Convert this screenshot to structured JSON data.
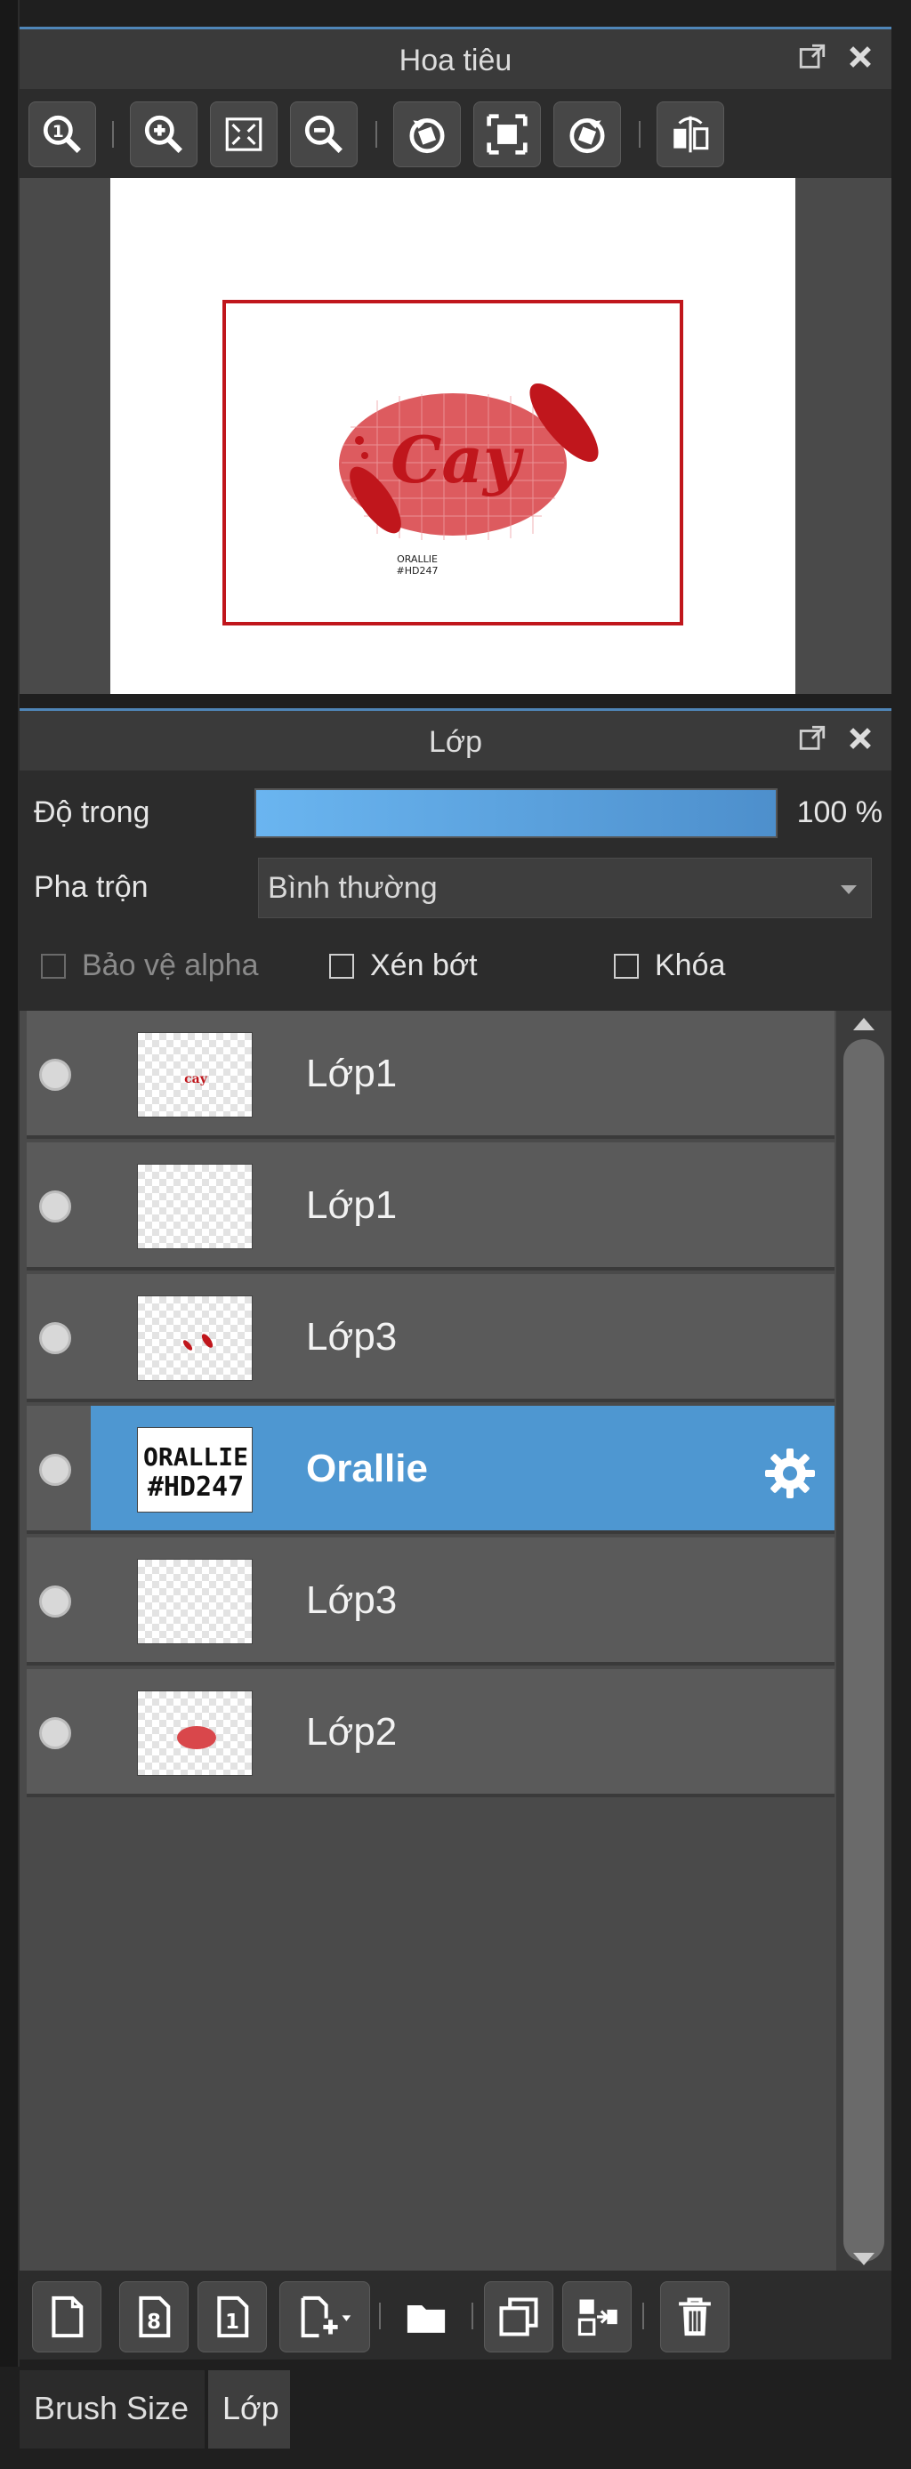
{
  "navigator": {
    "title": "Hoa tiêu",
    "preview": {
      "main_text": "Cay",
      "small_text_line1": "ORALLIE",
      "small_text_line2": "#HD247"
    },
    "tools": [
      "zoom-reset-icon",
      "zoom-in-icon",
      "fit-icon",
      "zoom-out-icon",
      "rotate-left-icon",
      "fit-window-icon",
      "rotate-right-icon",
      "flip-icon"
    ]
  },
  "layers_panel": {
    "title": "Lớp",
    "opacity_label": "Độ trong",
    "opacity_value": "100 %",
    "opacity_fraction": 1.0,
    "blend_label": "Pha trộn",
    "blend_value": "Bình thường",
    "protect_alpha": "Bảo vệ alpha",
    "clipping": "Xén bớt",
    "lock": "Khóa",
    "layers": [
      {
        "name": "Lớp1",
        "selected": false
      },
      {
        "name": "Lớp1",
        "selected": false
      },
      {
        "name": "Lớp3",
        "selected": false
      },
      {
        "name": "Orallie",
        "selected": true,
        "thumb_line1": "ORALLIE",
        "thumb_line2": "#HD247"
      },
      {
        "name": "Lớp3",
        "selected": false
      },
      {
        "name": "Lớp2",
        "selected": false
      }
    ]
  },
  "bottom_tools": [
    "new-layer-icon",
    "8bit-layer-icon",
    "1bit-layer-icon",
    "add-layer-menu-icon",
    "folder-icon",
    "duplicate-icon",
    "merge-icon",
    "delete-icon"
  ],
  "tabs": {
    "brush_size": "Brush Size",
    "layer": "Lớp"
  },
  "colors": {
    "accent": "#4e97d1",
    "brand_red": "#c0161c"
  }
}
